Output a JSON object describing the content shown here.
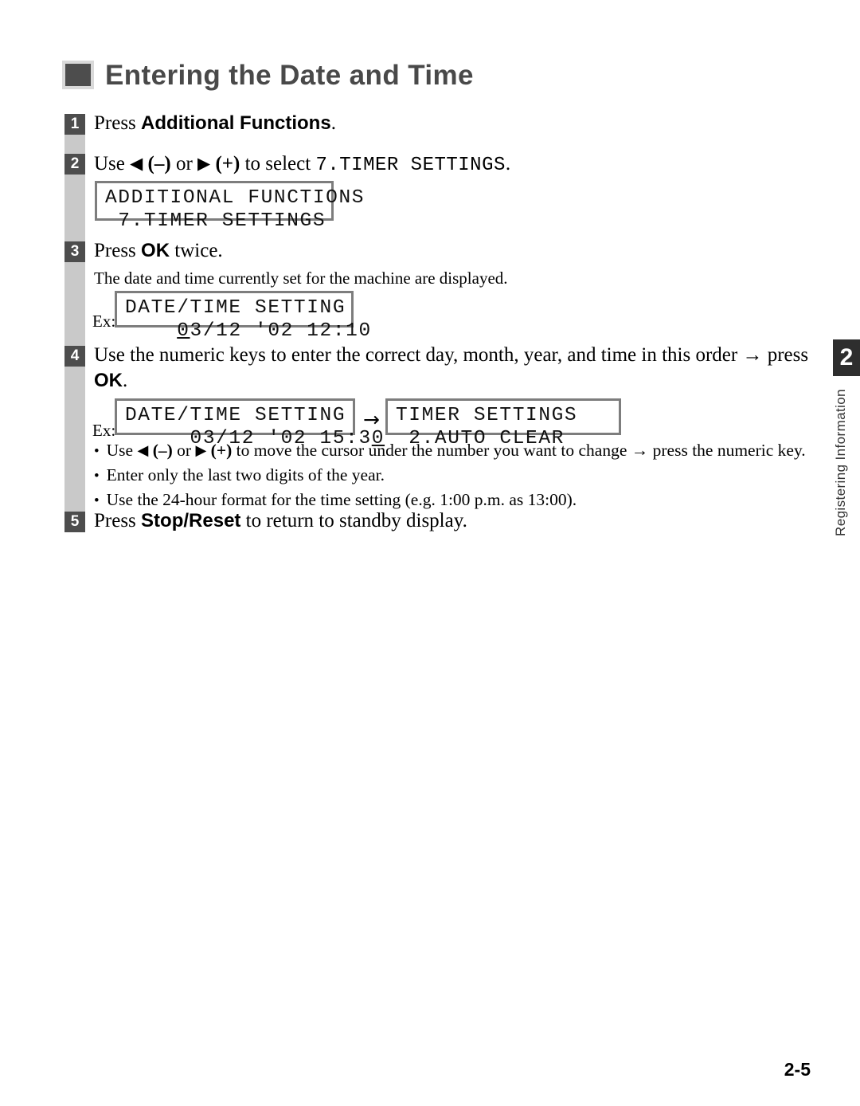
{
  "heading": {
    "bullet_icon": "square-bullet-icon",
    "title": "Entering the Date and Time"
  },
  "steps": [
    {
      "number": "1",
      "text_before": "Press ",
      "bold": "Additional Functions",
      "text_after": "."
    },
    {
      "number": "2",
      "text_before": "Use ",
      "left_arrow": "◀",
      "minus": "(–)",
      "middle": " or ",
      "right_arrow": "▶",
      "plus": "(+)",
      "text_after": " to select ",
      "mono": "7.TIMER SETTINGS",
      "period": "."
    },
    {
      "number": "3",
      "text_before": "Press ",
      "bold": "OK",
      "text_after": " twice.",
      "note": "The date and time currently set for the machine are displayed."
    },
    {
      "number": "4",
      "text_line1": "Use the numeric keys to enter the correct day, month, year, and time in this order → press",
      "bold": "OK",
      "text_after": "."
    },
    {
      "number": "5",
      "text_before": "Press ",
      "bold": "Stop/Reset",
      "text_after": " to return to standby display."
    }
  ],
  "lcd_displays": {
    "step2": {
      "line1": "ADDITIONAL FUNCTIONS",
      "line2": " 7.TIMER SETTINGS"
    },
    "step3": {
      "ex_label": "Ex:",
      "line1": "DATE/TIME SETTING",
      "line2_pre": "    ",
      "line2_cursor": "0",
      "line2_post": "3/12 '02 12:10"
    },
    "step4_left": {
      "ex_label": "Ex:",
      "line1": "DATE/TIME SETTING",
      "line2_pre": "     03/12 '02 15:3",
      "line2_cursor": "0",
      "line2_post": ""
    },
    "step4_arrow": "→",
    "step4_right": {
      "line1": "TIMER SETTINGS",
      "line2": " 2.AUTO CLEAR"
    }
  },
  "bullets": [
    {
      "dot": "•",
      "pre": "Use ",
      "left_arrow": "◀",
      "minus": "(–)",
      "mid": " or ",
      "right_arrow": "▶",
      "plus": "(+)",
      "post": " to move the cursor under the number you want to change → press the numeric key."
    },
    {
      "dot": "•",
      "text": "Enter only the last two digits of the year."
    },
    {
      "dot": "•",
      "text": "Use the 24-hour format for the time setting (e.g. 1:00 p.m. as 13:00)."
    }
  ],
  "side_tab": {
    "chapter_number": "2",
    "chapter_label": "Registering Information"
  },
  "footer": {
    "page_number": "2-5"
  },
  "colors": {
    "step_marker_bg": "#4d4d4d",
    "rail": "#c9c9c9",
    "heading": "#494949",
    "lcd_border": "#7d7d7d",
    "side_tab_bg": "#2e2e2e"
  }
}
